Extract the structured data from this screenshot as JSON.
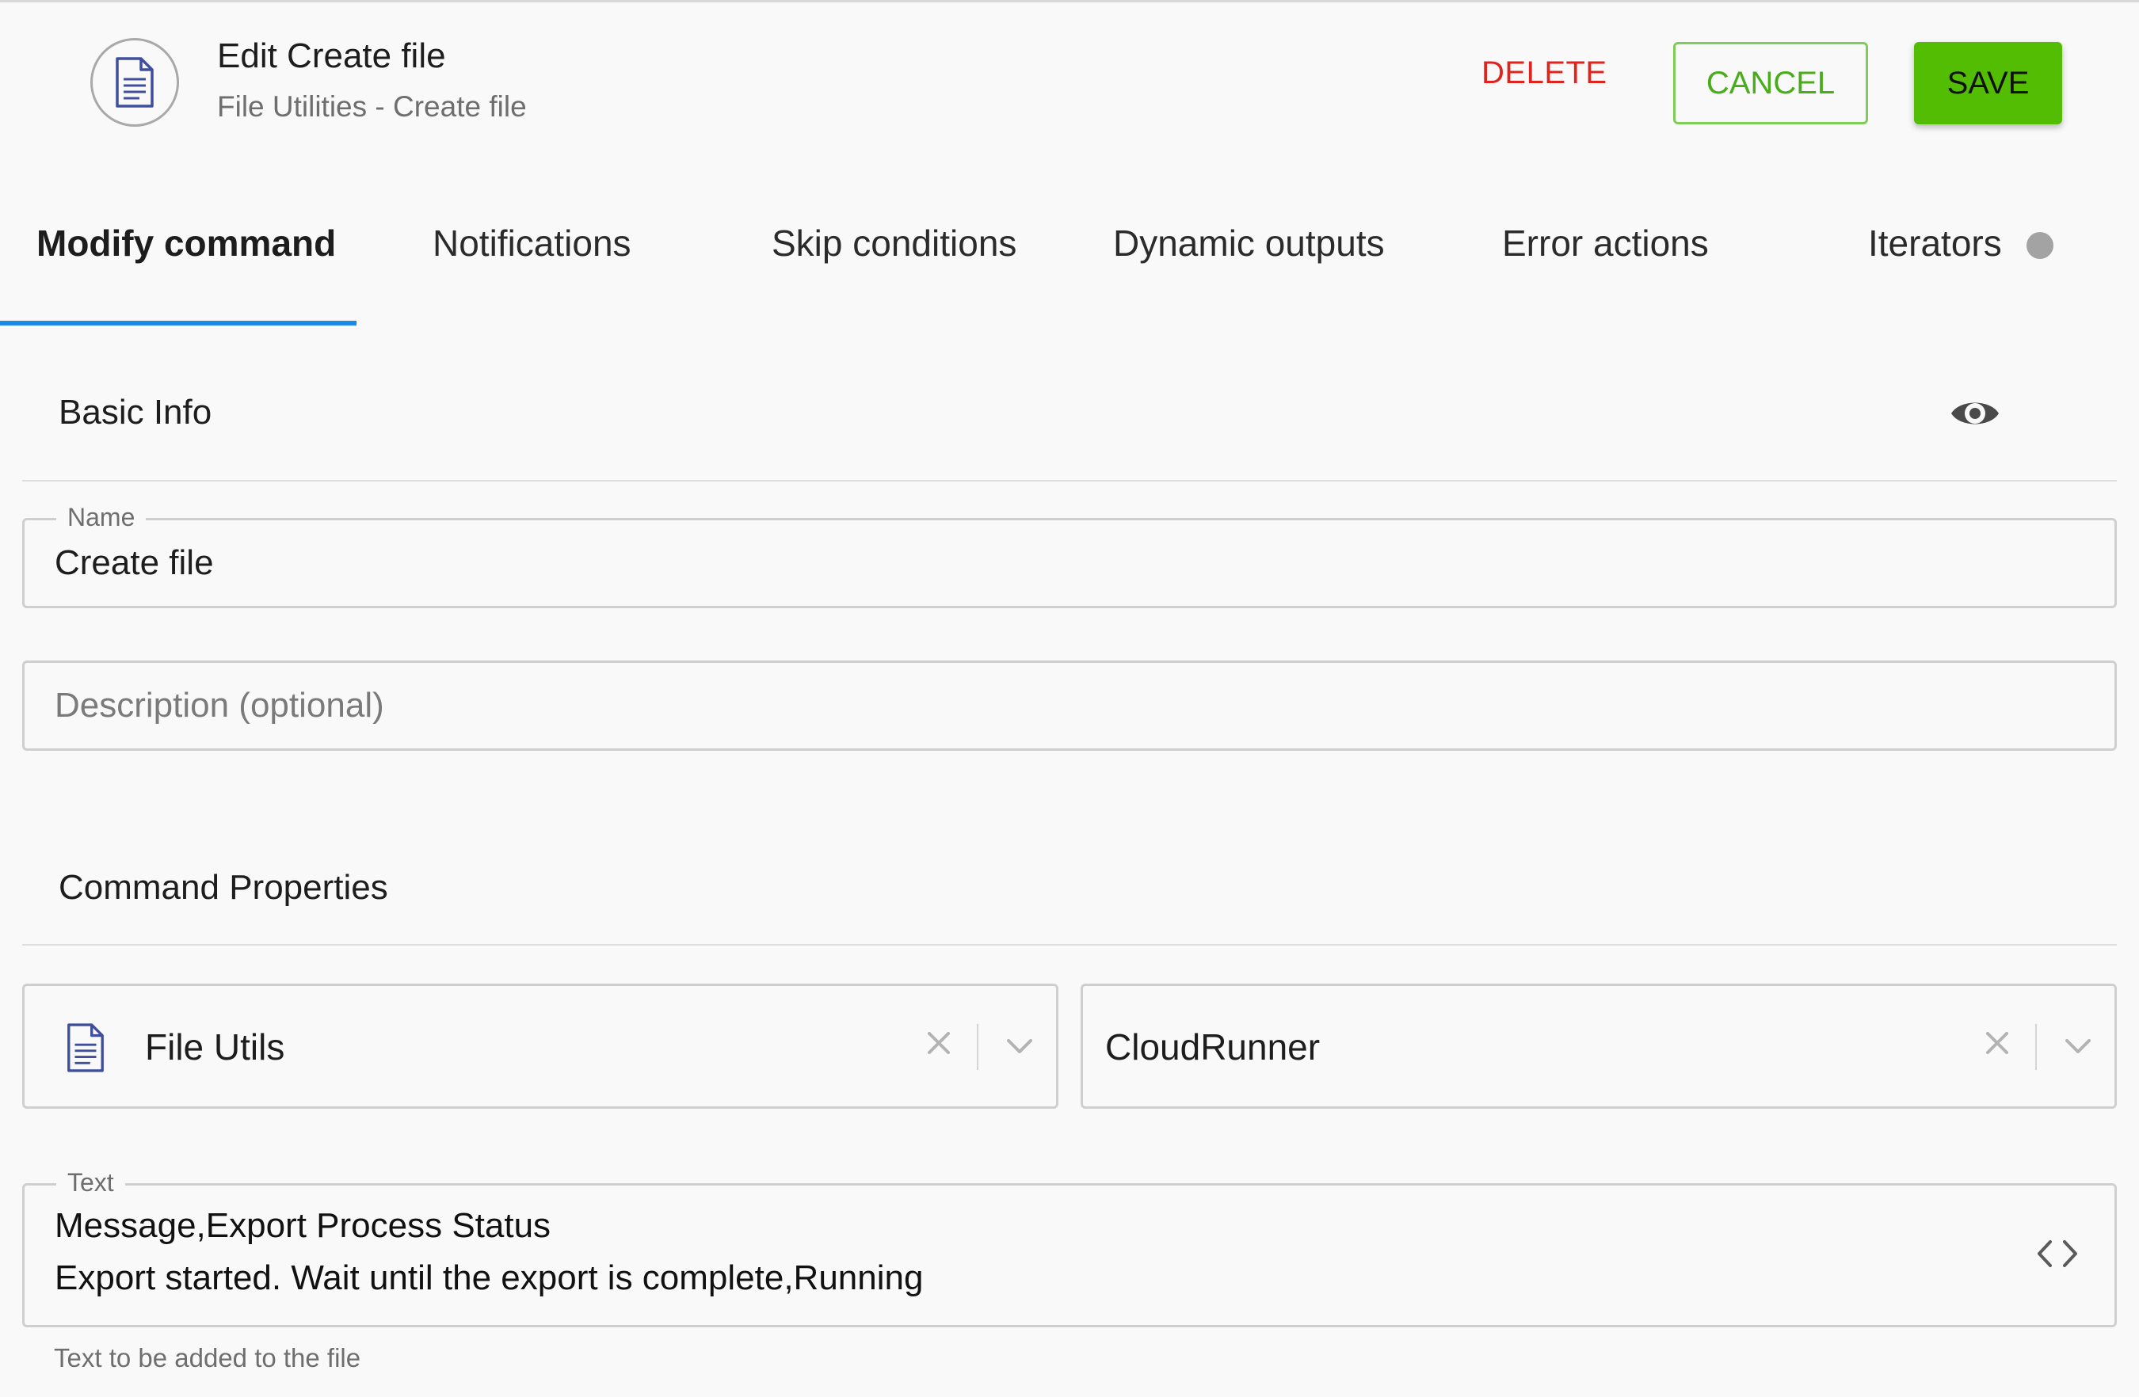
{
  "header": {
    "title": "Edit Create file",
    "subtitle": "File Utilities - Create file",
    "delete_label": "DELETE",
    "cancel_label": "CANCEL",
    "save_label": "SAVE",
    "icon": "document-icon"
  },
  "tabs": [
    {
      "label": "Modify command",
      "active": true
    },
    {
      "label": "Notifications",
      "active": false
    },
    {
      "label": "Skip conditions",
      "active": false
    },
    {
      "label": "Dynamic outputs",
      "active": false
    },
    {
      "label": "Error actions",
      "active": false
    },
    {
      "label": "Iterators",
      "active": false
    }
  ],
  "basic_info": {
    "title": "Basic Info",
    "name_label": "Name",
    "name_value": "Create file",
    "description_placeholder": "Description (optional)"
  },
  "command_properties": {
    "title": "Command Properties",
    "plugin_select": {
      "value": "File Utils",
      "icon": "document-icon"
    },
    "runner_select": {
      "value": "CloudRunner"
    },
    "text_label": "Text",
    "text_lines": [
      "Message,Export Process Status",
      "Export started. Wait until the export is complete,Running"
    ],
    "text_helper": "Text to be added to the file"
  },
  "colors": {
    "accent_blue": "#1e88e5",
    "save_green": "#52bd03",
    "cancel_green": "#49ad1a",
    "delete_red": "#e0231c"
  }
}
